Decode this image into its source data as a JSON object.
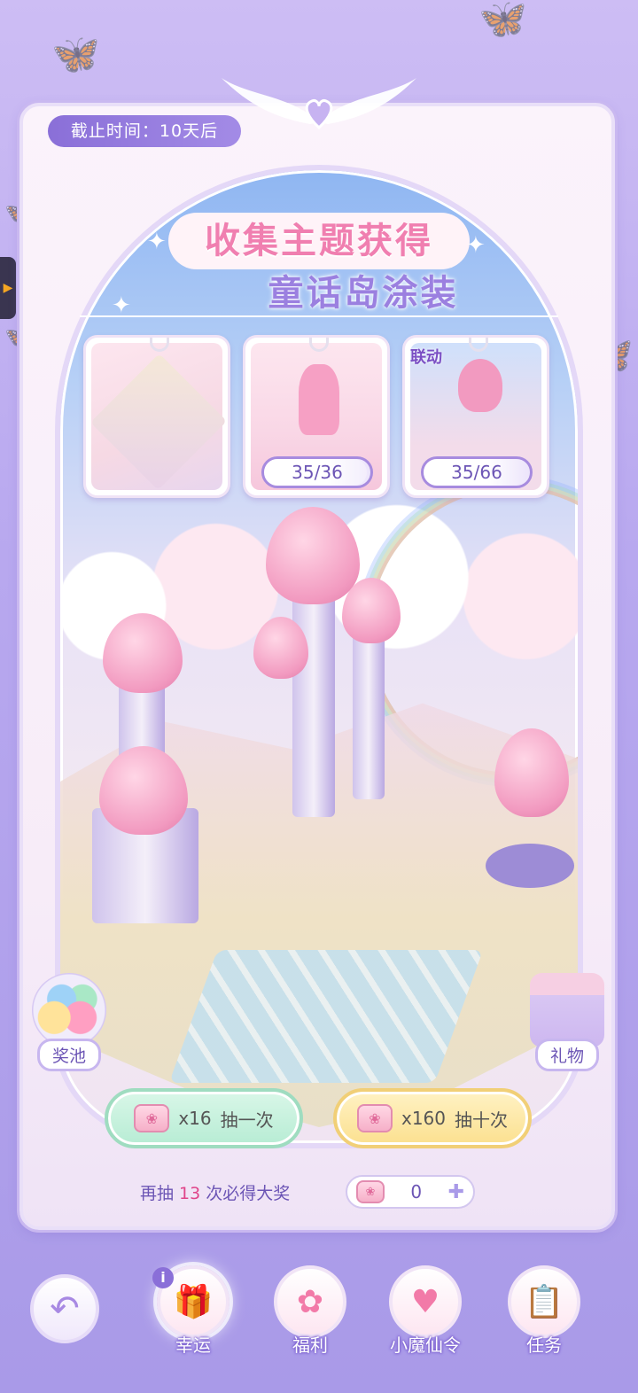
{
  "deadline": "截止时间：10天后",
  "title": {
    "line1": "收集主题获得",
    "line2": "童话岛涂装"
  },
  "cards": [
    {
      "progress": "",
      "badge": ""
    },
    {
      "progress": "35/36",
      "badge": "",
      "fraction": 0.97
    },
    {
      "progress": "35/66",
      "badge": "联动",
      "fraction": 0.53
    }
  ],
  "side": {
    "pool_label": "奖池",
    "gift_label": "礼物"
  },
  "draw": {
    "one": {
      "cost": "x16",
      "label": "抽一次"
    },
    "ten": {
      "cost": "x160",
      "label": "抽十次"
    }
  },
  "guarantee": {
    "prefix": "再抽 ",
    "count": "13",
    "suffix": " 次必得大奖"
  },
  "balance": "0",
  "nav": {
    "items": [
      {
        "label": "幸运",
        "icon": "gift-icon"
      },
      {
        "label": "福利",
        "icon": "flower-icon"
      },
      {
        "label": "小魔仙令",
        "icon": "heart-wings-icon"
      },
      {
        "label": "任务",
        "icon": "clipboard-icon"
      }
    ],
    "info": "i"
  },
  "colors": {
    "accent": "#8a6fd8",
    "highlight": "#e0458a",
    "draw_one": "#b7ecd4",
    "draw_ten": "#fbe08f"
  }
}
